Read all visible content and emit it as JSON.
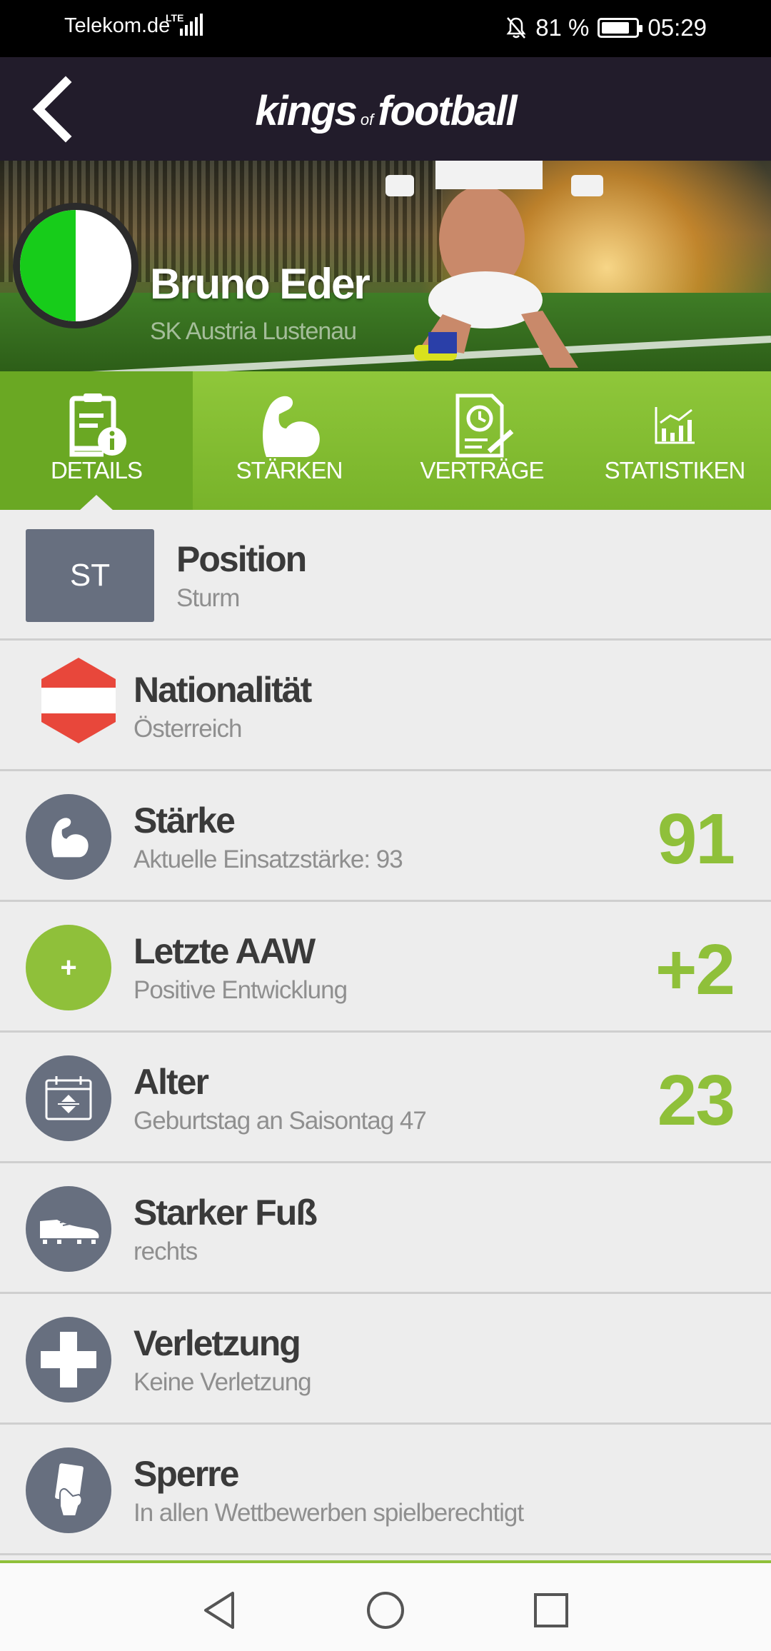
{
  "status_bar": {
    "carrier": "Telekom.de",
    "network": "LTE",
    "battery": "81 %",
    "battery_level": 0.81,
    "time": "05:29"
  },
  "app": {
    "logo_part1": "kings",
    "logo_part2": "of",
    "logo_part3": "football"
  },
  "player": {
    "name": "Bruno Eder",
    "club": "SK Austria Lustenau",
    "club_colors": [
      "#17cc1a",
      "#ffffff"
    ]
  },
  "tabs": [
    {
      "label": "DETAILS",
      "icon": "details-icon",
      "active": true
    },
    {
      "label": "STÄRKEN",
      "icon": "strength-icon",
      "active": false
    },
    {
      "label": "VERTRÄGE",
      "icon": "contract-icon",
      "active": false
    },
    {
      "label": "STATISTIKEN",
      "icon": "statistics-icon",
      "active": false
    }
  ],
  "details": {
    "position": {
      "badge": "ST",
      "title": "Position",
      "subtitle": "Sturm"
    },
    "nationality": {
      "title": "Nationalität",
      "subtitle": "Österreich",
      "flag_colors": [
        "#e8473b",
        "#ffffff",
        "#e8473b"
      ]
    },
    "strength": {
      "title": "Stärke",
      "subtitle": "Aktuelle Einsatzstärke: 93",
      "value": "91"
    },
    "last_aaw": {
      "title": "Letzte AAW",
      "subtitle": "Positive Entwicklung",
      "value": "+2",
      "icon_symbol": "+"
    },
    "age": {
      "title": "Alter",
      "subtitle": "Geburtstag an Saisontag 47",
      "value": "23"
    },
    "strong_foot": {
      "title": "Starker Fuß",
      "subtitle": "rechts"
    },
    "injury": {
      "title": "Verletzung",
      "subtitle": "Keine Verletzung"
    },
    "suspension": {
      "title": "Sperre",
      "subtitle": "In allen Wettbewerben spielberechtigt"
    }
  },
  "colors": {
    "accent_green": "#8fc03a",
    "icon_gray": "#676f7f",
    "header_dark": "#221c2b"
  }
}
